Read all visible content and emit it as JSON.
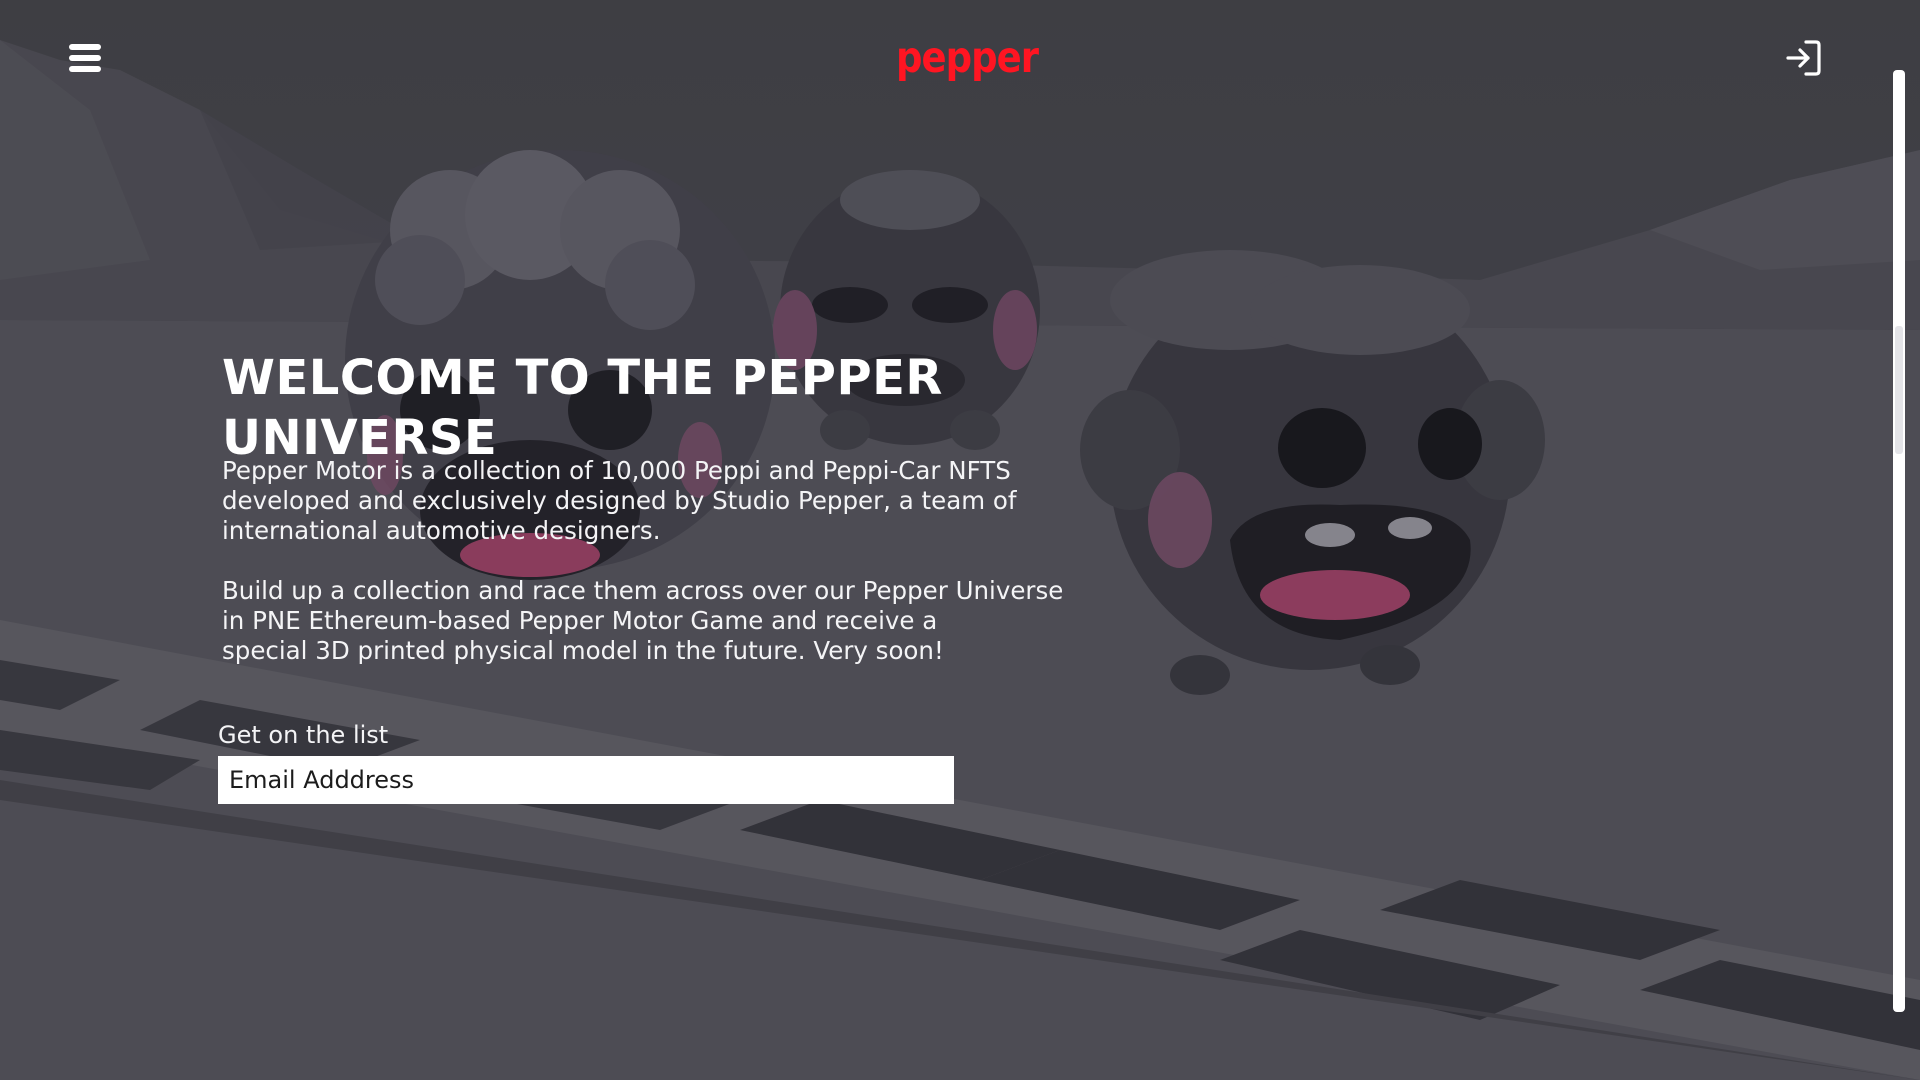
{
  "header": {
    "logo_text": "pepper",
    "menu_icon": "hamburger-menu-icon",
    "login_icon": "sign-in-arrow-icon"
  },
  "hero": {
    "title": "WELCOME TO THE PEPPER UNIVERSE",
    "paragraph_1": "Pepper Motor is a collection of 10,000 Peppi and Peppi-Car NFTS\ndeveloped and exclusively designed by Studio Pepper, a team of\ninternational automotive designers.",
    "paragraph_2": "Build up a collection and race them across over our Pepper Universe\nin PNE Ethereum-based Pepper Motor Game and receive a\nspecial 3D printed physical model in the future. Very soon!"
  },
  "signup": {
    "label": "Get on the list",
    "email_placeholder": "Email Adddress",
    "email_value": ""
  },
  "colors": {
    "brand": "#ff1522",
    "text": "#ffffff",
    "background": "#4a4a51"
  }
}
